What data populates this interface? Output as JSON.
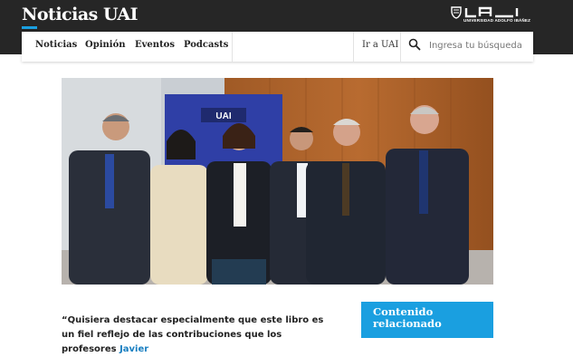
{
  "header": {
    "site_title": "Noticias UAI",
    "logo_label": "UNIVERSIDAD ADOLFO IBÁÑEZ",
    "colors": {
      "bar": "#262626",
      "accent": "#1a9fe0"
    }
  },
  "nav": {
    "items": [
      {
        "label": "Noticias"
      },
      {
        "label": "Opinión"
      },
      {
        "label": "Eventos"
      },
      {
        "label": "Podcasts"
      }
    ],
    "ir_uai": "Ir a UAI",
    "search_icon": "search-icon",
    "search_placeholder": "Ingresa tu búsqueda"
  },
  "hero": {
    "banner_logo_text": "UAI"
  },
  "article": {
    "quote_text": "“Quisiera destacar especialmente que este libro es un fiel reflejo de las contribuciones que los profesores ",
    "quote_link": "Javier"
  },
  "sidebar": {
    "related_title": "Contenido relacionado"
  }
}
